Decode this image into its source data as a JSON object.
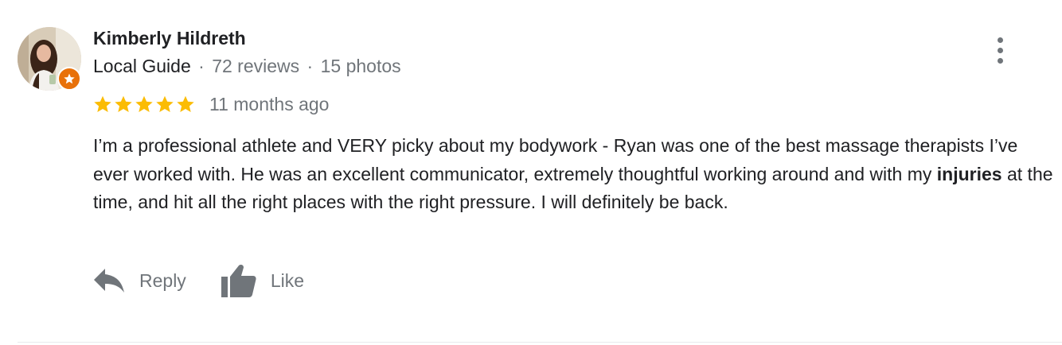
{
  "review": {
    "author": {
      "name": "Kimberly Hildreth",
      "badge": "Local Guide",
      "reviews_count": "72 reviews",
      "photos_count": "15 photos",
      "separator": "·",
      "badge_color": "#e8710a"
    },
    "rating": {
      "stars": 5,
      "max_stars": 5,
      "star_color": "#fbbc04",
      "time_ago": "11 months ago"
    },
    "text": {
      "part1": "I’m a professional athlete and VERY picky about my bodywork - Ryan was one of the best massage therapists I’ve ever worked with. He was an excellent communicator, extremely thoughtful working around and with my ",
      "highlight": "injuries",
      "part2": " at the time, and hit all the right places with the right pressure. I will definitely be back."
    },
    "actions": {
      "reply_label": "Reply",
      "like_label": "Like"
    },
    "icons": {
      "menu": "more-vert-icon",
      "reply": "reply-arrow-icon",
      "like": "thumbs-up-icon",
      "badge": "star-badge-icon"
    }
  }
}
